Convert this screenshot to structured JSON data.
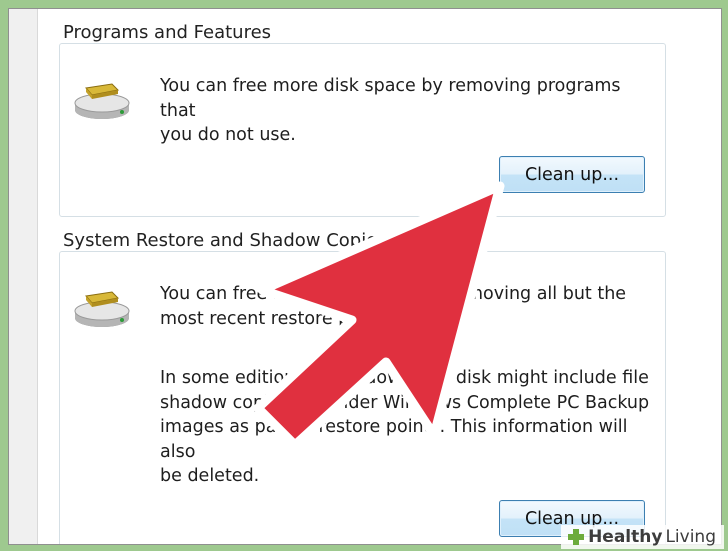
{
  "programs": {
    "title": "Programs and Features",
    "desc_line1": "You can free more disk space by removing programs that",
    "desc_line2": "you do not use.",
    "button_label": "Clean up..."
  },
  "restore": {
    "title": "System Restore and Shadow Copies",
    "desc_line1": "You can free more disk space by removing all but the",
    "desc_line2": "most recent restore point.",
    "desc2_line1": "In some editions of Windows, the disk might include file",
    "desc2_line2": "shadow copies and older Windows Complete PC Backup",
    "desc2_line3": "images as part of restore points. This information will also",
    "desc2_line4": "be deleted.",
    "button_label": "Clean up..."
  },
  "watermark": {
    "brand_bold": "Healthy",
    "brand_light": "Living"
  },
  "colors": {
    "arrow_fill": "#e0303f",
    "arrow_stroke": "#ffffff",
    "page_bg": "#9ec98f"
  }
}
